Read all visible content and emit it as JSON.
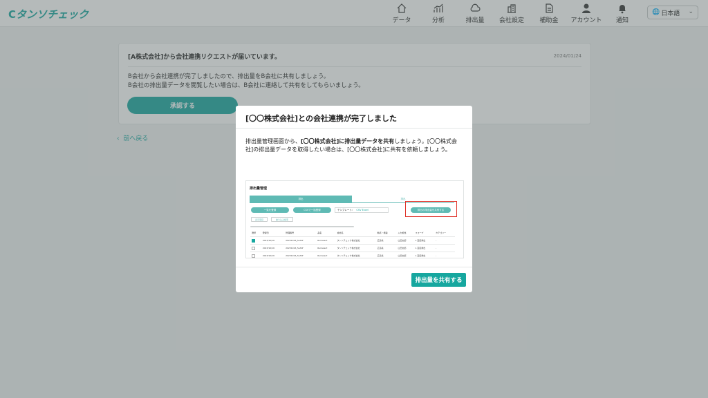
{
  "brand": {
    "logo_text": "タンソチェック",
    "accent": "#16a79f"
  },
  "nav": [
    {
      "label": "データ",
      "icon": "home-icon"
    },
    {
      "label": "分析",
      "icon": "chart-icon"
    },
    {
      "label": "排出量",
      "icon": "cloud-icon"
    },
    {
      "label": "会社設定",
      "icon": "building-icon"
    },
    {
      "label": "補助金",
      "icon": "document-icon"
    },
    {
      "label": "アカウント",
      "icon": "person-icon"
    },
    {
      "label": "通知",
      "icon": "bell-icon"
    }
  ],
  "language": {
    "selected": "日本語"
  },
  "request_card": {
    "title": "[A株式会社]から会社連携リクエストが届いています。",
    "date": "2024/01/24",
    "body_line1": "B会社から会社連携が完了しましたので、排出量をB会社に共有しましょう。",
    "body_line2": "B会社の排出量データを閲覧したい場合は、B会社に連絡して共有をしてもらいましょう。",
    "approve_label": "承認する"
  },
  "back_link": "前へ戻る",
  "modal": {
    "title": "[〇〇株式会社]との会社連携が完了しました",
    "desc_pre": "排出量管理画面から、",
    "desc_bold": "[〇〇株式会社]に排出量データを共有",
    "desc_post": "しましょう。[〇〇株式会社]の排出量データを取得したい場合は、[〇〇株式会社]に共有を依頼しましょう。",
    "share_button": "排出量を共有する",
    "preview": {
      "title": "排出量管理",
      "tab1": "排出",
      "tab2": "排出",
      "pill1": "一覧を登録",
      "pill2": "CSVで一括登録",
      "template_label": "テンプレート：",
      "template_links": "CSV  Excel",
      "share_pill": "排出の排出量を共有する",
      "small1": "表示項目",
      "small2": "絞り込み検索",
      "columns": [
        "選択",
        "登録日",
        "管理番号",
        "品名",
        "会社名",
        "拠点・施設",
        "入力担当",
        "スコープ",
        "カテゴリー"
      ],
      "rows": [
        [
          "",
          "2023/10/16",
          "20231016_5e3df",
          "Rumelect",
          "タンソチェック株式会社",
          "広島県",
          "山田太郎",
          "1.直接排出",
          "-"
        ],
        [
          "",
          "2023/10/16",
          "20231016_5e3df",
          "Rumelect",
          "タンソチェック株式会社",
          "広島県",
          "山田太郎",
          "1.直接排出",
          "-"
        ],
        [
          "",
          "2023/10/16",
          "20231016_5e3df",
          "Rumelect",
          "タンソチェック株式会社",
          "広島県",
          "山田太郎",
          "1.直接排出",
          "-"
        ]
      ]
    }
  }
}
